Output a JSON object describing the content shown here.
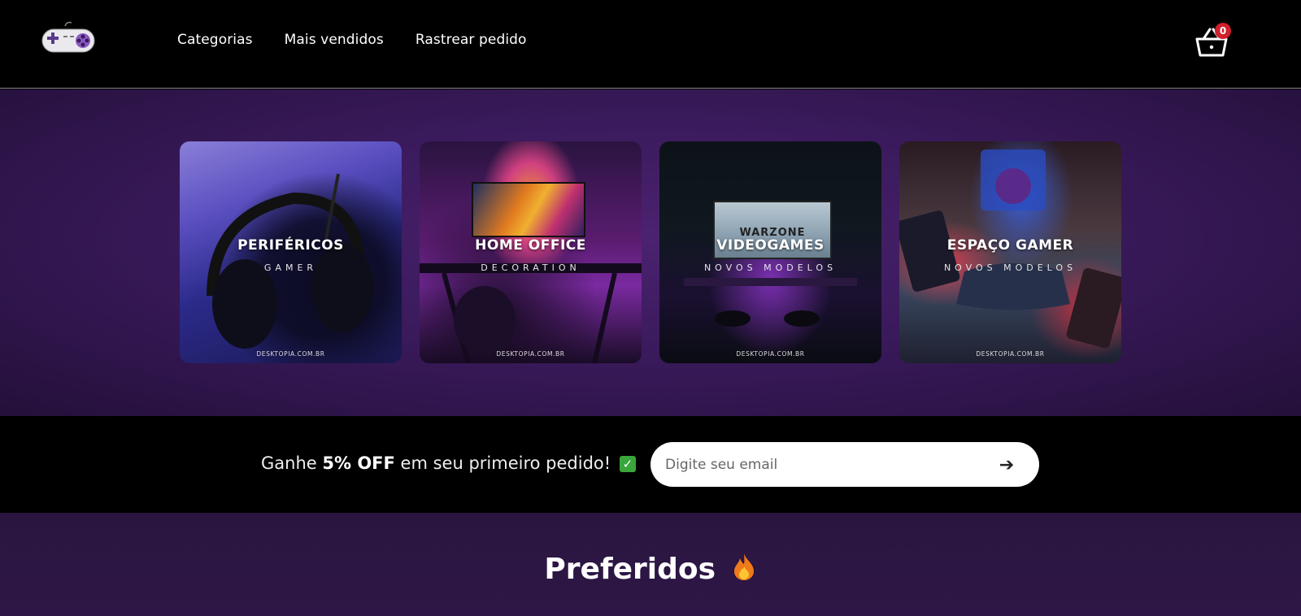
{
  "header": {
    "nav": [
      "Categorias",
      "Mais vendidos",
      "Rastrear pedido"
    ],
    "cart_count": "0"
  },
  "categories": [
    {
      "title": "PERIFÉRICOS",
      "subtitle": "GAMER",
      "site": "DESKTOPIA.COM.BR"
    },
    {
      "title": "HOME OFFICE",
      "subtitle": "DECORATION",
      "site": "DESKTOPIA.COM.BR"
    },
    {
      "title": "VIDEOGAMES",
      "subtitle": "NOVOS MODELOS",
      "site": "DESKTOPIA.COM.BR",
      "screen_text": "WARZONE"
    },
    {
      "title": "ESPAÇO GAMER",
      "subtitle": "NOVOS MODELOS",
      "site": "DESKTOPIA.COM.BR"
    }
  ],
  "newsletter": {
    "text_before": "Ganhe ",
    "highlight": "5% OFF",
    "text_after": " em seu primeiro pedido!",
    "check_icon": "✓",
    "email_placeholder": "Digite seu email",
    "submit_icon": "arrow-right-icon",
    "submit_glyph": "➔"
  },
  "favorites": {
    "title": "Preferidos"
  },
  "colors": {
    "accent_purple": "#3a1a5c",
    "badge_red": "#d0202a"
  }
}
